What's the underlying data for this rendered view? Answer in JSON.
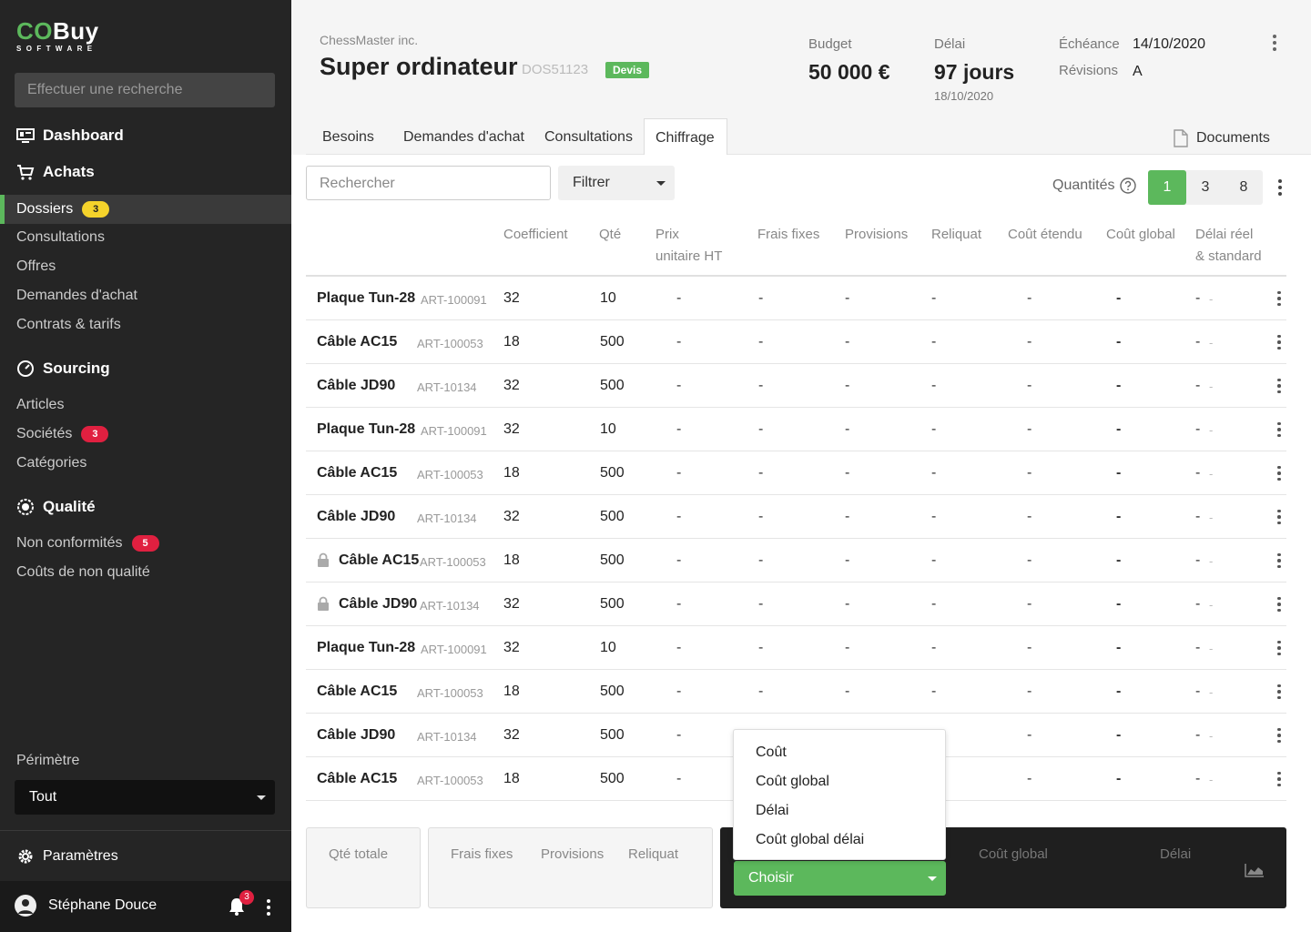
{
  "sidebar": {
    "logo_main_co": "CO",
    "logo_main_rest": "Buy",
    "logo_sub": "SOFTWARE",
    "search_placeholder": "Effectuer une recherche",
    "dashboard": "Dashboard",
    "achats": "Achats",
    "dossiers": "Dossiers",
    "dossiers_badge": "3",
    "consultations": "Consultations",
    "offres": "Offres",
    "demandes": "Demandes d'achat",
    "contrats": "Contrats & tarifs",
    "sourcing": "Sourcing",
    "articles": "Articles",
    "societes": "Sociétés",
    "societes_badge": "3",
    "categories": "Catégories",
    "qualite": "Qualité",
    "non_conformites": "Non conformités",
    "non_conformites_badge": "5",
    "couts_non_qualite": "Coûts de non qualité",
    "perimetre_label": "Périmètre",
    "perimetre_value": "Tout",
    "parametres": "Paramètres",
    "user_name": "Stéphane Douce",
    "notif_count": "3"
  },
  "header": {
    "company": "ChessMaster inc.",
    "title": "Super ordinateur",
    "dossier_code": "DOS51123",
    "status": "Devis",
    "budget_label": "Budget",
    "budget_value": "50 000 €",
    "delai_label": "Délai",
    "delai_value": "97 jours",
    "delai_date": "18/10/2020",
    "echeance_label": "Échéance",
    "echeance_value": "14/10/2020",
    "revisions_label": "Révisions",
    "revisions_value": "A"
  },
  "tabs": [
    "Besoins",
    "Demandes d'achat",
    "Consultations",
    "Chiffrage"
  ],
  "documents_tab": "Documents",
  "toolbar": {
    "search_placeholder": "Rechercher",
    "filter_label": "Filtrer",
    "quantities_label": "Quantités",
    "quantities": [
      "1",
      "3",
      "8"
    ]
  },
  "table": {
    "headers": {
      "coefficient": "Coefficient",
      "qte": "Qté",
      "prix1": "Prix",
      "prix2": "unitaire HT",
      "frais": "Frais fixes",
      "provisions": "Provisions",
      "reliquat": "Reliquat",
      "cout_etendu": "Coût étendu",
      "cout_global": "Coût global",
      "delai1": "Délai réel",
      "delai2": "& standard"
    },
    "rows": [
      {
        "name": "Plaque Tun-28",
        "art": "ART-100091",
        "coef": "32",
        "qty": "10",
        "locked": false
      },
      {
        "name": "Câble AC15",
        "art": "ART-100053",
        "coef": "18",
        "qty": "500",
        "locked": false
      },
      {
        "name": "Câble JD90",
        "art": "ART-10134",
        "coef": "32",
        "qty": "500",
        "locked": false
      },
      {
        "name": "Plaque Tun-28",
        "art": "ART-100091",
        "coef": "32",
        "qty": "10",
        "locked": false
      },
      {
        "name": "Câble AC15",
        "art": "ART-100053",
        "coef": "18",
        "qty": "500",
        "locked": false
      },
      {
        "name": "Câble JD90",
        "art": "ART-10134",
        "coef": "32",
        "qty": "500",
        "locked": false
      },
      {
        "name": "Câble AC15",
        "art": "ART-100053",
        "coef": "18",
        "qty": "500",
        "locked": true
      },
      {
        "name": "Câble JD90",
        "art": "ART-10134",
        "coef": "32",
        "qty": "500",
        "locked": true
      },
      {
        "name": "Plaque Tun-28",
        "art": "ART-100091",
        "coef": "32",
        "qty": "10",
        "locked": false
      },
      {
        "name": "Câble AC15",
        "art": "ART-100053",
        "coef": "18",
        "qty": "500",
        "locked": false
      },
      {
        "name": "Câble JD90",
        "art": "ART-10134",
        "coef": "32",
        "qty": "500",
        "locked": false
      },
      {
        "name": "Câble AC15",
        "art": "ART-100053",
        "coef": "18",
        "qty": "500",
        "locked": false
      }
    ],
    "dash": "-"
  },
  "footer": {
    "qte_totale": "Qté totale",
    "frais_fixes": "Frais fixes",
    "provisions": "Provisions",
    "reliquat": "Reliquat",
    "cout_global": "Coût global",
    "delai": "Délai",
    "choose_label": "Choisir",
    "dropdown_options": [
      "Coût",
      "Coût global",
      "Délai",
      "Coût global délai"
    ]
  }
}
